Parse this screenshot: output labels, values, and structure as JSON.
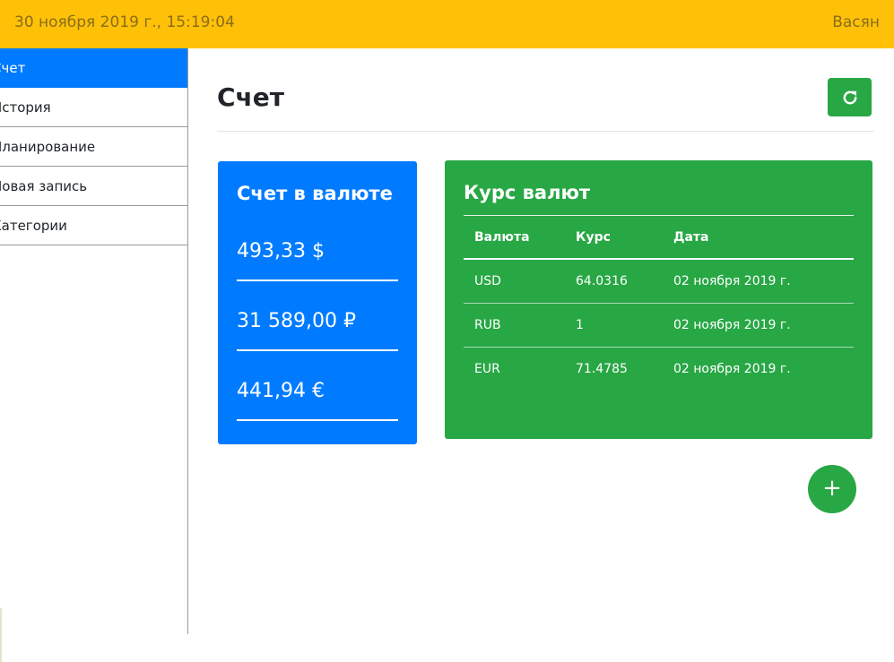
{
  "header": {
    "datetime": "30 ноября 2019 г., 15:19:04",
    "user": "Васян",
    "color": "#ffc107"
  },
  "sidebar": {
    "items": [
      {
        "label": "Счет",
        "active": true
      },
      {
        "label": "История",
        "active": false
      },
      {
        "label": "Планирование",
        "active": false
      },
      {
        "label": "Новая запись",
        "active": false
      },
      {
        "label": "Категории",
        "active": false
      }
    ]
  },
  "main": {
    "title": "Счет",
    "refresh_icon": "refresh-icon"
  },
  "balance_card": {
    "title": "Счет в валюте",
    "items": [
      "493,33 $",
      "31 589,00 ₽",
      "441,94 €"
    ],
    "color": "#007bff"
  },
  "rates_card": {
    "title": "Курс валют",
    "columns": [
      "Валюта",
      "Курс",
      "Дата"
    ],
    "rows": [
      [
        "USD",
        "64.0316",
        "02 ноября 2019 г."
      ],
      [
        "RUB",
        "1",
        "02 ноября 2019 г."
      ],
      [
        "EUR",
        "71.4785",
        "02 ноября 2019 г."
      ]
    ],
    "color": "#28a745"
  },
  "fab": {
    "label": "+",
    "icon": "plus-icon"
  }
}
